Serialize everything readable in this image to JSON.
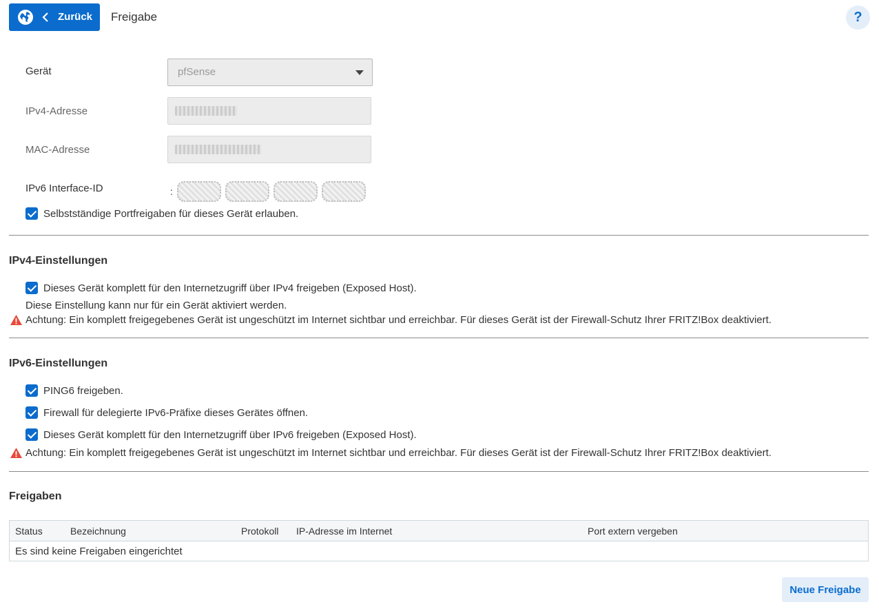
{
  "header": {
    "back_label": "Zurück",
    "title": "Freigabe",
    "help_label": "?",
    "icons": {
      "globe": "globe-icon",
      "back": "chevron-left-icon"
    }
  },
  "device": {
    "geraet_label": "Gerät",
    "geraet_value": "pfSense",
    "ipv4_label": "IPv4-Adresse",
    "mac_label": "MAC-Adresse",
    "ipv6_label": "IPv6 Interface-ID",
    "ipv6_prefix": ":",
    "auto_portfreigabe_label": "Selbstständige Portfreigaben für dieses Gerät erlauben.",
    "auto_portfreigabe_checked": true
  },
  "ipv4": {
    "title": "IPv4-Einstellungen",
    "exposed_host_label": "Dieses Gerät komplett für den Internetzugriff über IPv4 freigeben (Exposed Host).",
    "exposed_host_checked": true,
    "note": "Diese Einstellung kann nur für ein Gerät aktiviert werden.",
    "warning": "Achtung: Ein komplett freigegebenes Gerät ist ungeschützt im Internet sichtbar und erreichbar. Für dieses Gerät ist der Firewall-Schutz Ihrer FRITZ!Box deaktiviert."
  },
  "ipv6": {
    "title": "IPv6-Einstellungen",
    "ping6_label": "PING6 freigeben.",
    "firewall_label": "Firewall für delegierte IPv6-Präfixe dieses Gerätes öffnen.",
    "exposed_host_label": "Dieses Gerät komplett für den Internetzugriff über IPv6 freigeben (Exposed Host).",
    "warning": "Achtung: Ein komplett freigegebenes Gerät ist ungeschützt im Internet sichtbar und erreichbar. Für dieses Gerät ist der Firewall-Schutz Ihrer FRITZ!Box deaktiviert."
  },
  "freigaben": {
    "title": "Freigaben",
    "columns": [
      "Status",
      "Bezeichnung",
      "Protokoll",
      "IP-Adresse im Internet",
      "Port extern vergeben"
    ],
    "empty_text": "Es sind keine Freigaben eingerichtet",
    "new_button_label": "Neue Freigabe"
  },
  "colors": {
    "accent": "#0b6ccd",
    "warning": "#e8493a"
  }
}
